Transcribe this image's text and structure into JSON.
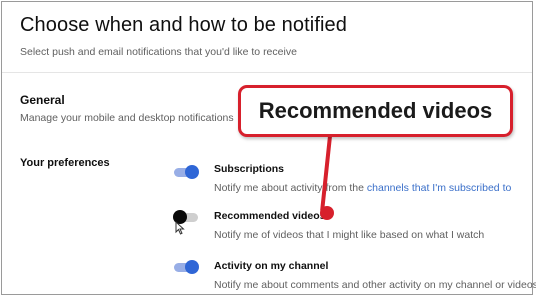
{
  "header": {
    "title": "Choose when and how to be notified",
    "subtitle": "Select push and email notifications that you'd like to receive"
  },
  "general": {
    "title": "General",
    "description": "Manage your mobile and desktop notifications"
  },
  "preferences": {
    "label": "Your preferences",
    "items": [
      {
        "title": "Subscriptions",
        "description_prefix": "Notify me about activity from the ",
        "description_link": "channels that I'm subscribed to",
        "enabled": true
      },
      {
        "title": "Recommended videos",
        "description": "Notify me of videos that I might like based on what I watch",
        "enabled": false
      },
      {
        "title": "Activity on my channel",
        "description": "Notify me about comments and other activity on my channel or videos",
        "enabled": true
      }
    ]
  },
  "annotation": {
    "callout_text": "Recommended videos",
    "color": "#d7202c"
  },
  "colors": {
    "toggle_on": "#2f66d6",
    "link": "#3a6fc9"
  }
}
